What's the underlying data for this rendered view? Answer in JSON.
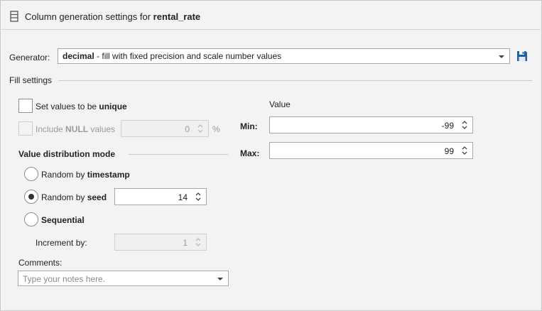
{
  "header": {
    "title_prefix": "Column generation settings for ",
    "column_name": "rental_rate",
    "icon": "column-icon"
  },
  "generator": {
    "label": "Generator:",
    "selected_name": "decimal",
    "selected_desc": " - fill with fixed precision and scale number values",
    "save_icon": "save-icon"
  },
  "fill_settings": {
    "title": "Fill settings",
    "unique": {
      "label_prefix": "Set values to be ",
      "label_bold": "unique",
      "checked": false
    },
    "include_null": {
      "label_prefix": "Include ",
      "label_bold": "NULL",
      "label_suffix": " values",
      "checked": false,
      "enabled": false,
      "value": "0",
      "unit": "%"
    },
    "distribution": {
      "title": "Value distribution mode",
      "options": [
        {
          "prefix": "Random by ",
          "bold": "timestamp",
          "checked": false
        },
        {
          "prefix": "Random by ",
          "bold": "seed",
          "checked": true,
          "seed_value": "14"
        },
        {
          "prefix": "",
          "bold": "Sequential",
          "checked": false
        }
      ],
      "increment": {
        "label": "Increment by:",
        "value": "1",
        "enabled": false
      }
    },
    "comments": {
      "label": "Comments:",
      "placeholder": "Type your notes here."
    },
    "value": {
      "title": "Value",
      "min_label": "Min:",
      "min_value": "-99",
      "max_label": "Max:",
      "max_value": "99"
    }
  }
}
